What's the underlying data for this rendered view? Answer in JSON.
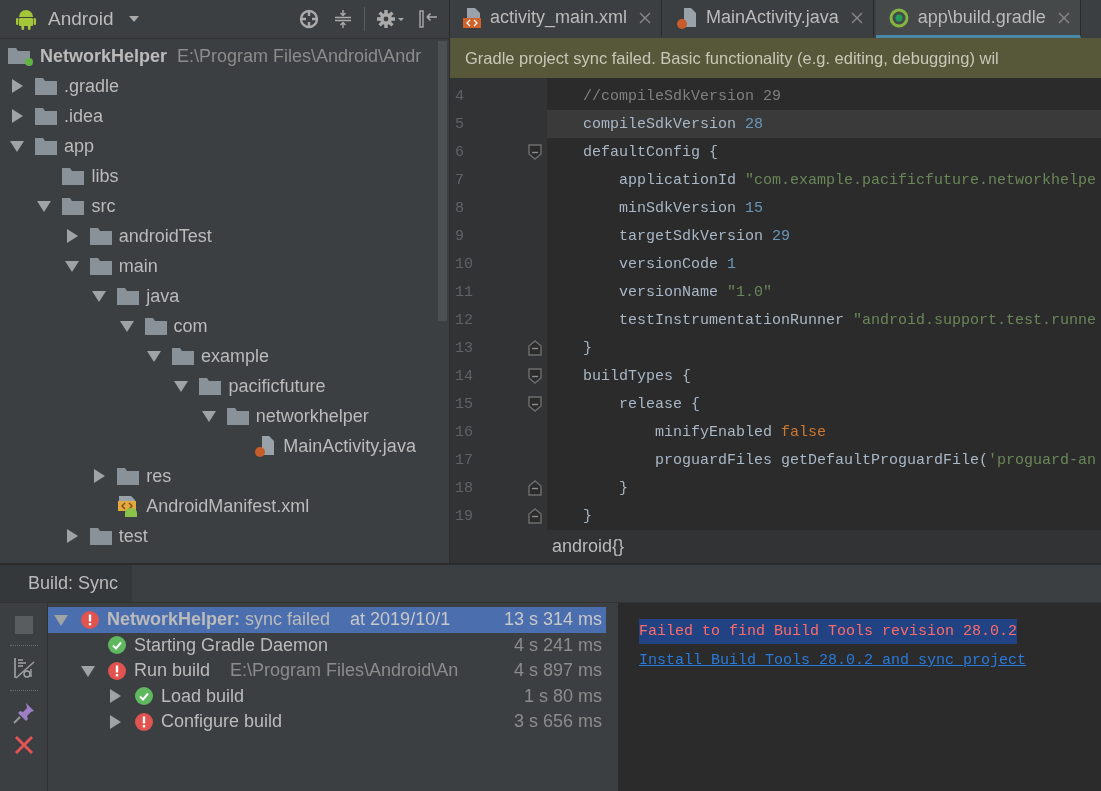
{
  "project_panel": {
    "view": "Android",
    "root": {
      "name": "NetworkHelper",
      "path": "E:\\Program Files\\Android\\Andr"
    },
    "tree": [
      {
        "label": ".gradle",
        "kind": "folder",
        "expanded": false
      },
      {
        "label": ".idea",
        "kind": "folder",
        "expanded": false
      },
      {
        "label": "app",
        "kind": "folder",
        "expanded": true,
        "children": [
          {
            "label": "libs",
            "kind": "folder"
          },
          {
            "label": "src",
            "kind": "folder",
            "expanded": true,
            "children": [
              {
                "label": "androidTest",
                "kind": "folder",
                "expanded": false
              },
              {
                "label": "main",
                "kind": "folder",
                "expanded": true,
                "children": [
                  {
                    "label": "java",
                    "kind": "folder",
                    "expanded": true,
                    "children": [
                      {
                        "label": "com",
                        "kind": "folder",
                        "expanded": true,
                        "children": [
                          {
                            "label": "example",
                            "kind": "folder",
                            "expanded": true,
                            "children": [
                              {
                                "label": "pacificfuture",
                                "kind": "folder",
                                "expanded": true,
                                "children": [
                                  {
                                    "label": "networkhelper",
                                    "kind": "folder",
                                    "expanded": true,
                                    "children": [
                                      {
                                        "label": "MainActivity.java",
                                        "kind": "java"
                                      }
                                    ]
                                  }
                                ]
                              }
                            ]
                          }
                        ]
                      }
                    ]
                  },
                  {
                    "label": "res",
                    "kind": "folder",
                    "expanded": false
                  },
                  {
                    "label": "AndroidManifest.xml",
                    "kind": "manifest"
                  }
                ]
              },
              {
                "label": "test",
                "kind": "folder",
                "expanded": false
              }
            ]
          }
        ]
      }
    ]
  },
  "editor": {
    "tabs": [
      {
        "label": "activity_main.xml",
        "kind": "xml",
        "selected": false
      },
      {
        "label": "MainActivity.java",
        "kind": "java",
        "selected": false
      },
      {
        "label": "app\\build.gradle",
        "kind": "gradle",
        "selected": true
      }
    ],
    "banner": "Gradle project sync failed. Basic functionality (e.g. editing, debugging) wil",
    "lines": [
      {
        "number": "4",
        "current": false,
        "tokens": [
          {
            "text": "    //compileSdkVersion 29",
            "kind": "comment"
          }
        ]
      },
      {
        "number": "5",
        "current": true,
        "tokens": [
          {
            "text": "    compileSdkVersion ",
            "kind": "plain"
          },
          {
            "text": "28",
            "kind": "number"
          }
        ]
      },
      {
        "number": "6",
        "current": false,
        "kind": "fold-start",
        "tokens": [
          {
            "text": "    defaultConfig {",
            "kind": "plain"
          }
        ]
      },
      {
        "number": "7",
        "current": false,
        "tokens": [
          {
            "text": "        applicationId ",
            "kind": "plain"
          },
          {
            "text": "\"com.example.pacificfuture.networkhelpe",
            "kind": "string"
          }
        ]
      },
      {
        "number": "8",
        "current": false,
        "tokens": [
          {
            "text": "        minSdkVersion ",
            "kind": "plain"
          },
          {
            "text": "15",
            "kind": "number"
          }
        ]
      },
      {
        "number": "9",
        "current": false,
        "tokens": [
          {
            "text": "        targetSdkVersion ",
            "kind": "plain"
          },
          {
            "text": "29",
            "kind": "number"
          }
        ]
      },
      {
        "number": "10",
        "current": false,
        "tokens": [
          {
            "text": "        versionCode ",
            "kind": "plain"
          },
          {
            "text": "1",
            "kind": "number"
          }
        ]
      },
      {
        "number": "11",
        "current": false,
        "tokens": [
          {
            "text": "        versionName ",
            "kind": "plain"
          },
          {
            "text": "\"1.0\"",
            "kind": "string"
          }
        ]
      },
      {
        "number": "12",
        "current": false,
        "tokens": [
          {
            "text": "        testInstrumentationRunner ",
            "kind": "plain"
          },
          {
            "text": "\"android.support.test.runne",
            "kind": "string"
          }
        ]
      },
      {
        "number": "13",
        "current": false,
        "kind": "fold-end",
        "tokens": [
          {
            "text": "    }",
            "kind": "plain"
          }
        ]
      },
      {
        "number": "14",
        "current": false,
        "kind": "fold-start",
        "tokens": [
          {
            "text": "    buildTypes {",
            "kind": "plain"
          }
        ]
      },
      {
        "number": "15",
        "current": false,
        "kind": "fold-start",
        "tokens": [
          {
            "text": "        release {",
            "kind": "plain"
          }
        ]
      },
      {
        "number": "16",
        "current": false,
        "tokens": [
          {
            "text": "            minifyEnabled ",
            "kind": "plain"
          },
          {
            "text": "false",
            "kind": "keyword"
          }
        ]
      },
      {
        "number": "17",
        "current": false,
        "tokens": [
          {
            "text": "            proguardFiles getDefaultProguardFile(",
            "kind": "plain"
          },
          {
            "text": "'proguard-an",
            "kind": "string"
          }
        ]
      },
      {
        "number": "18",
        "current": false,
        "kind": "fold-end",
        "tokens": [
          {
            "text": "        }",
            "kind": "plain"
          }
        ]
      },
      {
        "number": "19",
        "current": false,
        "kind": "fold-end",
        "tokens": [
          {
            "text": "    }",
            "kind": "plain"
          }
        ]
      }
    ],
    "breadcrumb": "android{}"
  },
  "build_panel": {
    "tab": "Build: Sync",
    "rows": [
      {
        "title": "**NetworkHelper:** sync failed",
        "detail": "at 2019/10/1",
        "time": "13 s 314 ms",
        "kind": "error",
        "expanded": true,
        "selected": true,
        "children": [
          {
            "title": "Starting Gradle Daemon",
            "time": "4 s 241 ms",
            "kind": "ok",
            "selected": false
          },
          {
            "title": "Run build",
            "detail": "E:\\Program Files\\Android\\An",
            "time": "4 s 897 ms",
            "kind": "error",
            "expanded": true,
            "selected": false,
            "children": [
              {
                "title": "Load build",
                "time": "1 s 80 ms",
                "kind": "ok",
                "expanded": false,
                "selected": false
              },
              {
                "title": "Configure build",
                "time": "3 s 656 ms",
                "kind": "error",
                "expanded": false,
                "selected": false
              }
            ]
          }
        ]
      }
    ],
    "console": [
      {
        "text": "Failed to find Build Tools revision 28.0.2",
        "kind": "error",
        "selected": true
      },
      {
        "text": "Install Build Tools 28.0.2 and sync project",
        "kind": "link",
        "selected": false
      }
    ]
  }
}
